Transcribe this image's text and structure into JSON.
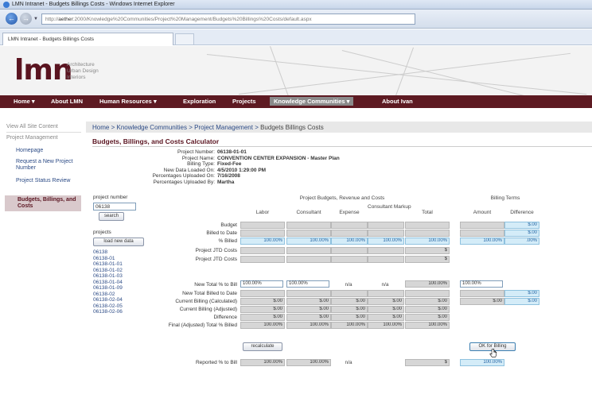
{
  "window": {
    "title": "LMN Intranet - Budgets Billings Costs - Windows Internet Explorer"
  },
  "address": {
    "prefix": "http://",
    "host": "aether",
    "rest": ":2000/Knowledge%20Communities/Project%20Management/Budgets%20Billings%20Costs/default.aspx"
  },
  "tab": {
    "label": "LMN Intranet - Budgets Billings Costs"
  },
  "site": {
    "logo": "lmn",
    "sub1": "Architecture",
    "sub2": "Urban Design",
    "sub3": "Interiors"
  },
  "topnav": [
    "Home ▾",
    "About LMN",
    "Human Resources ▾",
    "Exploration",
    "Projects",
    "Knowledge Communities ▾",
    "About Ivan"
  ],
  "sidebar": {
    "view_all": "View All Site Content",
    "group": "Project Management",
    "items": [
      "Homepage",
      "Request a New Project Number",
      "Project Status Review",
      "Budgets, Billings, and Costs"
    ]
  },
  "breadcrumb": {
    "a": "Home",
    "b": "Knowledge Communities",
    "c": "Project Management",
    "cur": "Budgets Billings Costs",
    "sep": ">"
  },
  "page_title": "Budgets, Billings, and Costs Calculator",
  "info": {
    "labels": [
      "Project Number:",
      "Project Name:",
      "Billing Type:",
      "New Data Loaded On:",
      "Percentages Uploaded On:",
      "Percentages Uploaded By:"
    ],
    "values": [
      "06138-01-01",
      "CONVENTION CENTER EXPANSION - Master Plan",
      "Fixed-Fee",
      "4/5/2010 1:29:00 PM",
      "7/16/2008",
      "Martha"
    ]
  },
  "left": {
    "pn_label": "project number",
    "pn_value": "06138",
    "search": "search",
    "projects_label": "projects",
    "load": "load new data",
    "projects": [
      "06138",
      "06138-01",
      "06138-01-01",
      "06138-01-02",
      "06138-01-03",
      "06138-01-04",
      "06138-01-09",
      "06138-02",
      "06138-02-04",
      "06138-02-05",
      "06138-02-06"
    ]
  },
  "table": {
    "group1": "Project Budgets, Revenue and Costs",
    "group2": "Billing Terms",
    "cols": [
      "Labor",
      "Consultant",
      "Expense",
      "Consultant Markup",
      "Total",
      "Amount",
      "Difference"
    ],
    "row_labels": [
      "Budget",
      "Billed to Date",
      "% Billed",
      "Project JTD Costs",
      "Project JTD Costs"
    ],
    "pct_billed": "100.00%",
    "pct_billed_diff": ".00%",
    "money_zero": "$.00",
    "currency": "$",
    "new_total_pct_label": "New Total % to Bill",
    "new_total_pct": "100.00%",
    "na": "n/a",
    "lower_labels": [
      "New Total Billed to Date",
      "Current Billing (Calculated)",
      "Current Billing (Adjusted)",
      "Difference",
      "Final (Adjusted) Total % Billed"
    ],
    "final_pct": "100.00%",
    "recalc": "recalculate",
    "ok": "OK for Billing",
    "reported_label": "Reported % to Bill",
    "reported": "100.00%"
  },
  "colors": {
    "brand": "#5d1a22",
    "link": "#2c4b86",
    "highlight": "#d4ecf8"
  }
}
